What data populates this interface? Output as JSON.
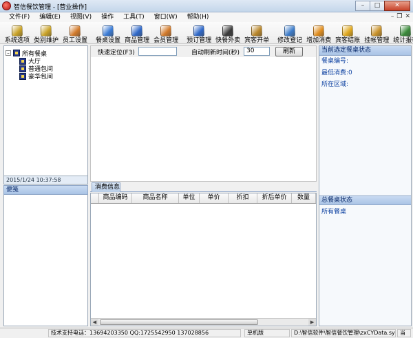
{
  "window": {
    "title": "智信餐饮管理 - [营业操作]",
    "min": "–",
    "max": "□",
    "close": "✕"
  },
  "menu": {
    "items": [
      "文件(F)",
      "编辑(E)",
      "视图(V)",
      "操作",
      "工具(T)",
      "窗口(W)",
      "帮助(H)"
    ],
    "mdi": [
      "–",
      "❐",
      "✕"
    ]
  },
  "toolbar": {
    "items": [
      {
        "label": "系统选项",
        "icon": "key-icon",
        "color": "#c9a227"
      },
      {
        "label": "类别维护",
        "icon": "key-icon",
        "color": "#c9a227"
      },
      {
        "label": "员工设置",
        "icon": "user-icon",
        "color": "#d27a2a"
      },
      {
        "label": "餐桌设置",
        "icon": "table-icon",
        "color": "#3a7bd5"
      },
      {
        "label": "商品管理",
        "icon": "box-icon",
        "color": "#2f68c8"
      },
      {
        "label": "会员管理",
        "icon": "user-icon",
        "color": "#d27a2a"
      },
      {
        "label": "预订管理",
        "icon": "book-icon",
        "color": "#2f68c8"
      },
      {
        "label": "快餐外卖",
        "icon": "phone-icon",
        "color": "#3a3a3a"
      },
      {
        "label": "宾客开单",
        "icon": "package-icon",
        "color": "#b9862a"
      },
      {
        "label": "修改登记",
        "icon": "edit-icon",
        "color": "#3d7cc9"
      },
      {
        "label": "增加消费",
        "icon": "cart-icon",
        "color": "#e08d1e"
      },
      {
        "label": "宾客结账",
        "icon": "coin-icon",
        "color": "#e0a81e"
      },
      {
        "label": "挂帐管理",
        "icon": "money-bag-icon",
        "color": "#c9922a"
      },
      {
        "label": "统计报表",
        "icon": "chart-icon",
        "color": "#3a8a3a"
      }
    ]
  },
  "tree": {
    "toggle": "–",
    "root": "所有餐桌",
    "children": [
      "大厅",
      "普通包间",
      "豪华包间"
    ]
  },
  "left": {
    "datetime": "2015/1/24 10:37:58",
    "memo_title": "便笺"
  },
  "quick": {
    "locate_label": "快速定位(F3)",
    "locate_value": "",
    "refresh_label": "自动刷新时间(秒)",
    "refresh_value": "30",
    "refresh_button": "刷新"
  },
  "consumption": {
    "tab": "消费信息",
    "columns": [
      "商品编码",
      "商品名称",
      "单位",
      "单价",
      "折扣",
      "折后单价",
      "数量"
    ],
    "rows": []
  },
  "right": {
    "current_title": "当前选定餐桌状态",
    "table_no": "餐桌编号:",
    "min_spend": "最低消费:0",
    "area": "所在区域:",
    "total_title": "总餐桌状态",
    "all_tables": "所有餐桌"
  },
  "status": {
    "support": "技术支持电话：13694203350 QQ:1725542950 137028856",
    "mode": "单机版",
    "path": "D:\\智信软件\\智信餐饮管理\\zxCYData.sys",
    "extra": "当"
  }
}
